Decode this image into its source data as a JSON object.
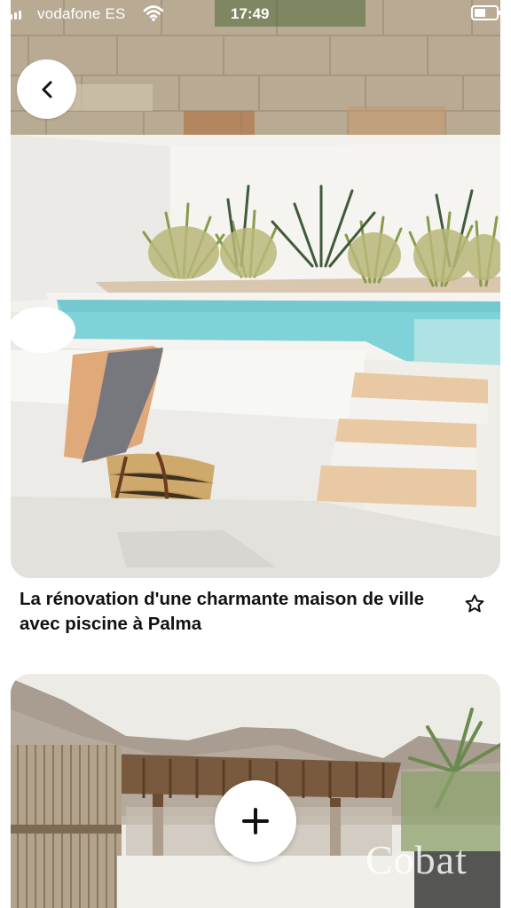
{
  "status_bar": {
    "carrier": "vodafone ES",
    "time": "17:49",
    "icons": [
      "signal-icon",
      "wifi-icon",
      "battery-icon"
    ]
  },
  "navigation": {
    "back_icon": "chevron-left-icon"
  },
  "pins": [
    {
      "title": "La rénovation d'une charmante maison de ville avec piscine à Palma",
      "save_icon": "star-outline-icon"
    },
    {
      "watermark": "Cobat"
    }
  ],
  "fab": {
    "icon": "plus-icon"
  },
  "colors": {
    "background": "#ffffff",
    "text": "#111111",
    "pool_water": "#7fd3d8",
    "wall_white": "#f3f2ee",
    "stone_wall": "#b5a790"
  }
}
